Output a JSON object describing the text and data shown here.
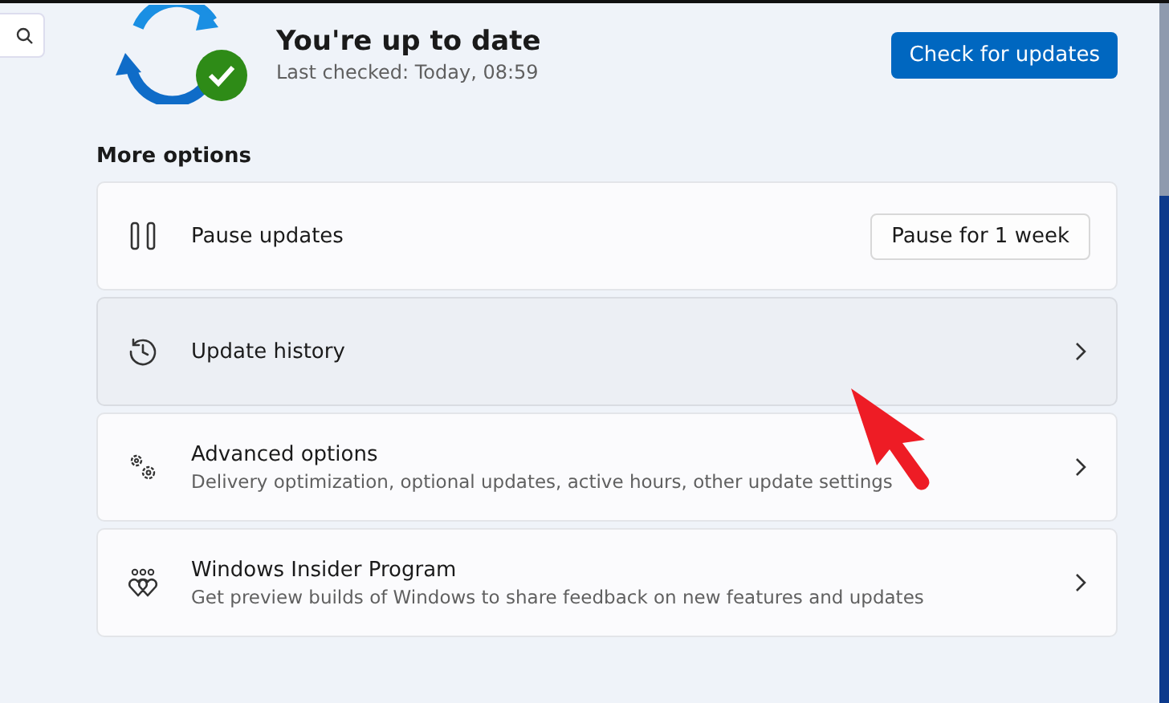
{
  "status": {
    "title": "You're up to date",
    "subtitle": "Last checked: Today, 08:59"
  },
  "check_button": "Check for updates",
  "section_title": "More options",
  "options": [
    {
      "kind": "button",
      "title": "Pause updates",
      "button": "Pause for 1 week",
      "hovered": false
    },
    {
      "kind": "link",
      "title": "Update history",
      "hovered": true
    },
    {
      "kind": "link",
      "title": "Advanced options",
      "subtitle": "Delivery optimization, optional updates, active hours, other update settings",
      "hovered": false
    },
    {
      "kind": "link",
      "title": "Windows Insider Program",
      "subtitle": "Get preview builds of Windows to share feedback on new features and updates",
      "hovered": false
    }
  ]
}
